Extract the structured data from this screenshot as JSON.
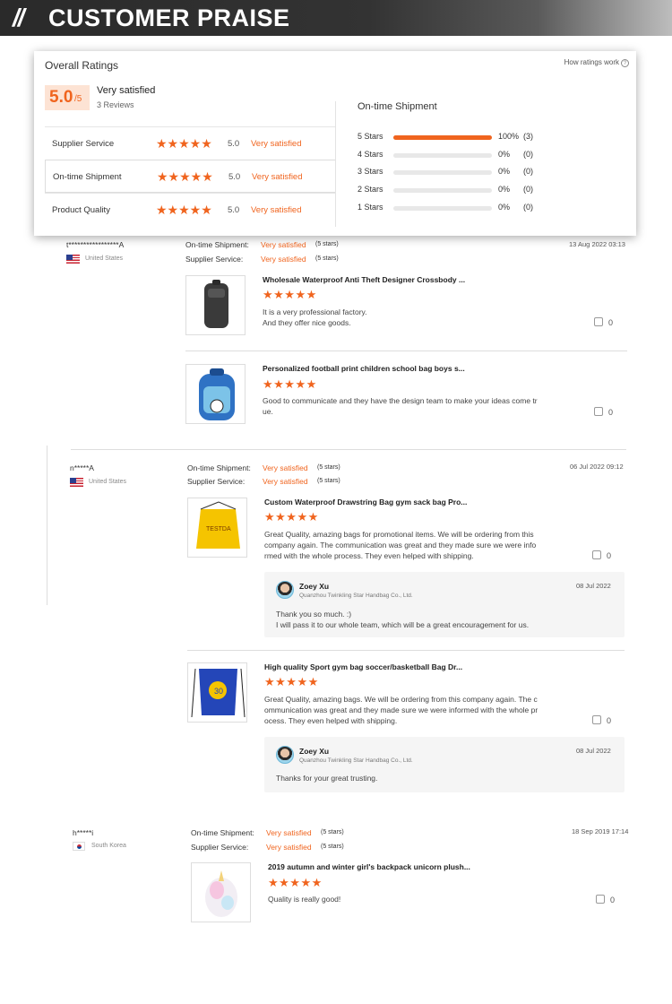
{
  "banner": {
    "slashes": "//",
    "title": "CUSTOMER PRAISE"
  },
  "overall": {
    "title": "Overall Ratings",
    "how_link": "How ratings work",
    "score": "5.0",
    "score_of": "/5",
    "summary_label": "Very satisfied",
    "reviews_count": "3 Reviews",
    "criteria": [
      {
        "name": "Supplier Service",
        "stars": "★★★★★",
        "score": "5.0",
        "label": "Very satisfied"
      },
      {
        "name": "On-time Shipment",
        "stars": "★★★★★",
        "score": "5.0",
        "label": "Very satisfied"
      },
      {
        "name": "Product Quality",
        "stars": "★★★★★",
        "score": "5.0",
        "label": "Very satisfied"
      }
    ],
    "breakdown_title": "On-time Shipment",
    "breakdown": [
      {
        "label": "5 Stars",
        "pct": "100%",
        "count": "(3)",
        "fill": 1.0
      },
      {
        "label": "4 Stars",
        "pct": "0%",
        "count": "(0)",
        "fill": 0
      },
      {
        "label": "3 Stars",
        "pct": "0%",
        "count": "(0)",
        "fill": 0
      },
      {
        "label": "2 Stars",
        "pct": "0%",
        "count": "(0)",
        "fill": 0
      },
      {
        "label": "1 Stars",
        "pct": "0%",
        "count": "(0)",
        "fill": 0
      }
    ]
  },
  "reviews": [
    {
      "user": "t*****************A",
      "country": "United States",
      "ots_label": "On-time Shipment:",
      "ots_value": "Very satisfied",
      "ots_stars": "(5 stars)",
      "ss_label": "Supplier Service:",
      "ss_value": "Very satisfied",
      "ss_stars": "(5 stars)",
      "date": "13 Aug 2022 03:13",
      "products": [
        {
          "title": "Wholesale Waterproof Anti Theft Designer Crossbody ...",
          "stars": "★★★★★",
          "comment_1": "It is a very professional factory.",
          "comment_2": "And they offer nice goods.",
          "likes": "0"
        },
        {
          "title": "Personalized football print children school bag boys s...",
          "stars": "★★★★★",
          "comment_1": "Good to communicate and they have the design team to make your ideas come tr",
          "comment_2": "ue.",
          "likes": "0"
        }
      ]
    },
    {
      "user": "n*****A",
      "country": "United States",
      "ots_label": "On-time Shipment:",
      "ots_value": "Very satisfied",
      "ots_stars": "(5 stars)",
      "ss_label": "Supplier Service:",
      "ss_value": "Very satisfied",
      "ss_stars": "(5 stars)",
      "date": "06 Jul 2022 09:12",
      "products": [
        {
          "title": "Custom Waterproof Drawstring Bag gym sack bag Pro...",
          "stars": "★★★★★",
          "comment_1": "Great Quality, amazing bags for promotional items.  We will be ordering from this",
          "comment_2": "company again.  The communication was great and they made sure we were info",
          "comment_3": "rmed with the whole process.  They even helped with shipping.",
          "likes": "0",
          "reply": {
            "name": "Zoey Xu",
            "company": "Quanzhou Twinkling Star Handbag Co., Ltd.",
            "date": "08 Jul 2022",
            "text_1": "Thank you so much. :)",
            "text_2": "I will pass it to our whole team, which will be a great encouragement for us."
          }
        },
        {
          "title": "High quality Sport gym bag soccer/basketball Bag Dr...",
          "stars": "★★★★★",
          "comment_1": "Great Quality, amazing bags.  We will be ordering from this company again.  The c",
          "comment_2": "ommunication was great and they made sure we were informed with the whole pr",
          "comment_3": "ocess.  They even helped with shipping.",
          "likes": "0",
          "reply": {
            "name": "Zoey Xu",
            "company": "Quanzhou Twinkling Star Handbag Co., Ltd.",
            "date": "08 Jul 2022",
            "text_1": "Thanks for your great trusting."
          }
        }
      ]
    },
    {
      "user": "h*****i",
      "country": "South Korea",
      "ots_label": "On-time Shipment:",
      "ots_value": "Very satisfied",
      "ots_stars": "(5 stars)",
      "ss_label": "Supplier Service:",
      "ss_value": "Very satisfied",
      "ss_stars": "(5 stars)",
      "date": "18 Sep 2019 17:14",
      "products": [
        {
          "title": "2019 autumn and winter girl's backpack unicorn plush...",
          "stars": "★★★★★",
          "comment_1": "Quality is really good!",
          "likes": "0"
        }
      ]
    }
  ],
  "colors": {
    "accent": "#f0641e",
    "banner": "#2f2f2f"
  }
}
